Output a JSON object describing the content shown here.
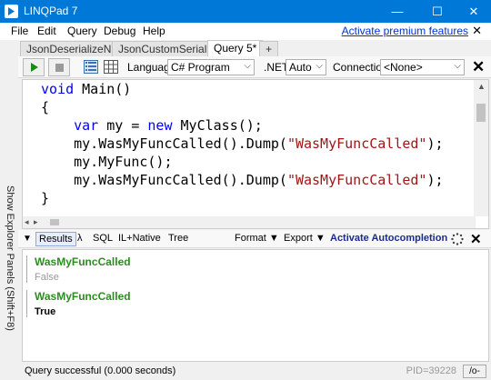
{
  "window": {
    "title": "LINQPad 7",
    "minimize": "—",
    "maximize": "☐",
    "close": "✕"
  },
  "menu": {
    "items": [
      "File",
      "Edit",
      "Query",
      "Debug",
      "Help"
    ],
    "premium_link": "Activate premium features",
    "close": "✕"
  },
  "tabs": [
    {
      "label": "JsonDeserializeNull*",
      "active": false
    },
    {
      "label": "JsonCustomSerializer*",
      "active": false
    },
    {
      "label": "Query 5*",
      "active": true
    },
    {
      "label": "+",
      "active": false
    }
  ],
  "toolbar": {
    "language_label": "Language",
    "language_value": "C# Program",
    "net_label": ".NET",
    "net_value": "Auto",
    "connection_label": "Connection",
    "connection_value": "<None>",
    "close": "✕"
  },
  "sidebar": {
    "label": "Show Explorer Panels (Shift+F8)"
  },
  "code": [
    [
      {
        "t": "void",
        "c": "kw"
      },
      {
        "t": " Main()",
        "c": ""
      }
    ],
    [
      {
        "t": "{",
        "c": ""
      }
    ],
    [
      {
        "t": "    ",
        "c": ""
      },
      {
        "t": "var",
        "c": "kw"
      },
      {
        "t": " my = ",
        "c": ""
      },
      {
        "t": "new",
        "c": "kw"
      },
      {
        "t": " MyClass();",
        "c": ""
      }
    ],
    [
      {
        "t": "    my.WasMyFuncCalled().Dump(",
        "c": ""
      },
      {
        "t": "\"WasMyFuncCalled\"",
        "c": "str"
      },
      {
        "t": ");",
        "c": ""
      }
    ],
    [
      {
        "t": "    my.MyFunc();",
        "c": ""
      }
    ],
    [
      {
        "t": "    my.WasMyFuncCalled().Dump(",
        "c": ""
      },
      {
        "t": "\"WasMyFuncCalled\"",
        "c": "str"
      },
      {
        "t": ");",
        "c": ""
      }
    ],
    [
      {
        "t": "}",
        "c": ""
      }
    ]
  ],
  "results_tabs": {
    "results": "Results",
    "lambda": "λ",
    "sql": "SQL",
    "il": "IL+Native",
    "tree": "Tree",
    "format": "Format",
    "export": "Export",
    "autocompletion": "Activate Autocompletion",
    "close": "✕"
  },
  "results": [
    {
      "header": "WasMyFuncCalled",
      "value": "False"
    },
    {
      "header": "WasMyFuncCalled",
      "value": "True"
    }
  ],
  "status": {
    "text": "Query successful  (0.000 seconds)",
    "pid": "PID=39228",
    "optimize": "/o-"
  },
  "colors": {
    "titlebar": "#0078d7",
    "keyword": "#0000ff",
    "string": "#a31515",
    "result_header": "#2e8b22"
  }
}
